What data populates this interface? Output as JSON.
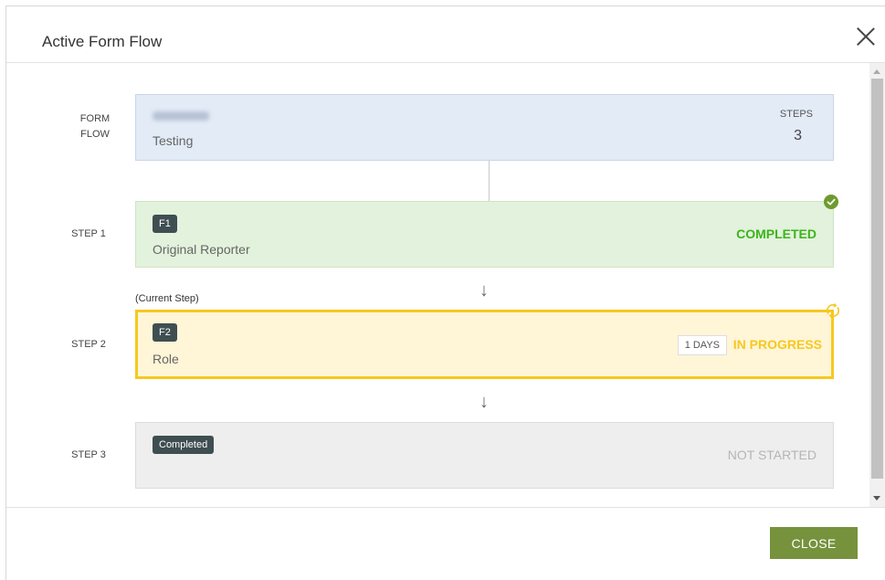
{
  "modal": {
    "title": "Active Form Flow"
  },
  "form_flow": {
    "row_label_line1": "FORM",
    "row_label_line2": "FLOW",
    "subtitle": "Testing",
    "steps_label": "STEPS",
    "steps_value": "3"
  },
  "current_step_label": "(Current Step)",
  "steps": [
    {
      "row_label": "STEP 1",
      "badge": "F1",
      "subtitle": "Original Reporter",
      "status": "COMPLETED",
      "status_color": "#3db31c"
    },
    {
      "row_label": "STEP 2",
      "badge": "F2",
      "subtitle": "Role",
      "days": "1 DAYS",
      "status": "IN PROGRESS",
      "status_color": "#f6c81f"
    },
    {
      "row_label": "STEP 3",
      "badge": "Completed",
      "status": "NOT STARTED",
      "status_color": "#b5b5b5"
    }
  ],
  "footer": {
    "close_label": "CLOSE"
  },
  "colors": {
    "accent_green": "#76923c",
    "progress_yellow": "#f6c81f"
  },
  "icons": {
    "close": "x-icon",
    "completed": "check-circle-icon",
    "in_progress": "refresh-icon",
    "arrow": "arrow-down-icon"
  }
}
